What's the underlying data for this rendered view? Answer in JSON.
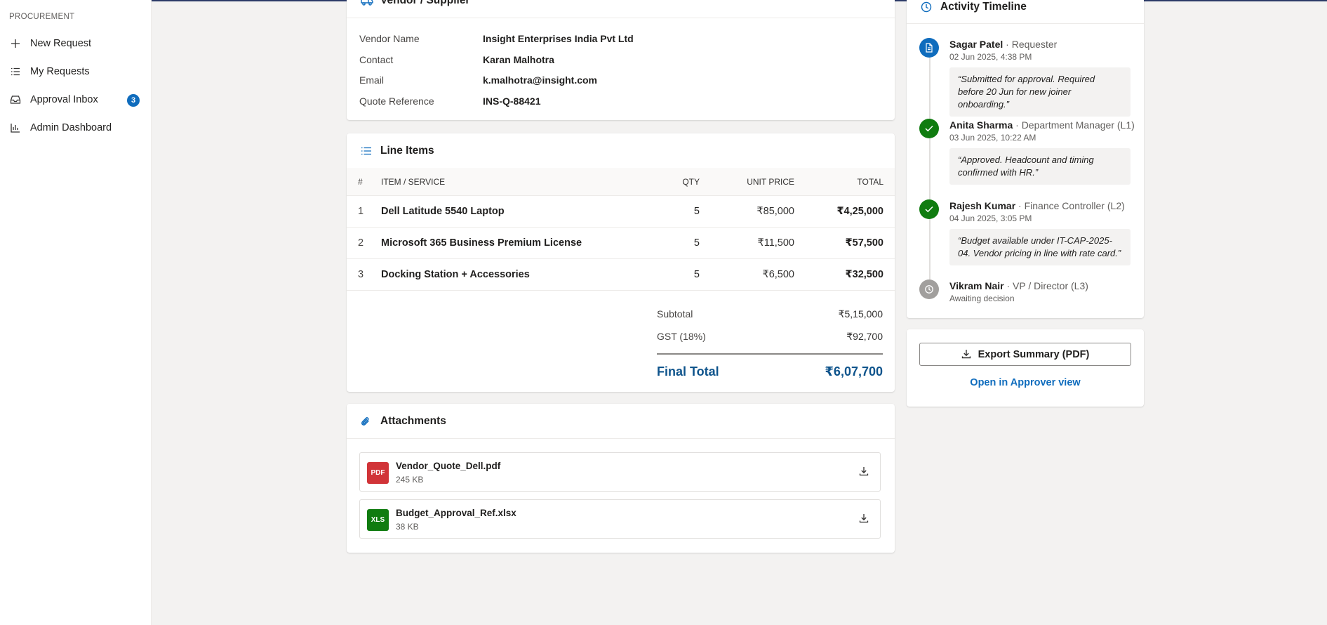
{
  "sidebar": {
    "section_title": "PROCUREMENT",
    "items": [
      {
        "label": "New Request",
        "icon": "plus-icon"
      },
      {
        "label": "My Requests",
        "icon": "list-icon"
      },
      {
        "label": "Approval Inbox",
        "icon": "inbox-icon",
        "badge": "3"
      },
      {
        "label": "Admin Dashboard",
        "icon": "chart-icon"
      }
    ]
  },
  "vendor": {
    "title": "Vendor / Supplier",
    "fields": [
      {
        "label": "Vendor Name",
        "value": "Insight Enterprises India Pvt Ltd"
      },
      {
        "label": "Contact",
        "value": "Karan Malhotra"
      },
      {
        "label": "Email",
        "value": "k.malhotra@insight.com"
      },
      {
        "label": "Quote Reference",
        "value": "INS-Q-88421"
      }
    ]
  },
  "line_items": {
    "title": "Line Items",
    "columns": {
      "num": "#",
      "item": "ITEM / SERVICE",
      "qty": "QTY",
      "unit": "UNIT PRICE",
      "total": "TOTAL"
    },
    "rows": [
      {
        "num": "1",
        "item": "Dell Latitude 5540 Laptop",
        "qty": "5",
        "unit": "₹85,000",
        "total": "₹4,25,000"
      },
      {
        "num": "2",
        "item": "Microsoft 365 Business Premium License",
        "qty": "5",
        "unit": "₹11,500",
        "total": "₹57,500"
      },
      {
        "num": "3",
        "item": "Docking Station + Accessories",
        "qty": "5",
        "unit": "₹6,500",
        "total": "₹32,500"
      }
    ],
    "subtotal_label": "Subtotal",
    "subtotal_value": "₹5,15,000",
    "gst_label": "GST (18%)",
    "gst_value": "₹92,700",
    "final_label": "Final Total",
    "final_value": "₹6,07,700"
  },
  "attachments": {
    "title": "Attachments",
    "files": [
      {
        "badge": "PDF",
        "name": "Vendor_Quote_Dell.pdf",
        "size": "245 KB",
        "color": "#d13438"
      },
      {
        "badge": "XLS",
        "name": "Budget_Approval_Ref.xlsx",
        "size": "38 KB",
        "color": "#107c10"
      }
    ]
  },
  "timeline": {
    "title": "Activity Timeline",
    "entries": [
      {
        "name": "Sagar Patel",
        "role": " · Requester",
        "time": "02 Jun 2025, 4:38 PM",
        "note": "“Submitted for approval. Required before 20 Jun for new joiner onboarding.”",
        "status": "submitted",
        "color": "#0f6cbd"
      },
      {
        "name": "Anita Sharma",
        "role": " · Department Manager (L1)",
        "time": "03 Jun 2025, 10:22 AM",
        "note": "“Approved. Headcount and timing confirmed with HR.”",
        "status": "approved",
        "color": "#107c10"
      },
      {
        "name": "Rajesh Kumar",
        "role": " · Finance Controller (L2)",
        "time": "04 Jun 2025, 3:05 PM",
        "note": "“Budget available under IT-CAP-2025-04. Vendor pricing in line with rate card.”",
        "status": "approved",
        "color": "#107c10"
      },
      {
        "name": "Vikram Nair",
        "role": " · VP / Director (L3)",
        "time": "Awaiting decision",
        "note": "",
        "status": "pending",
        "color": "#a19f9d"
      }
    ]
  },
  "actions": {
    "export_label": "Export Summary (PDF)",
    "approver_link": "Open in Approver view"
  }
}
